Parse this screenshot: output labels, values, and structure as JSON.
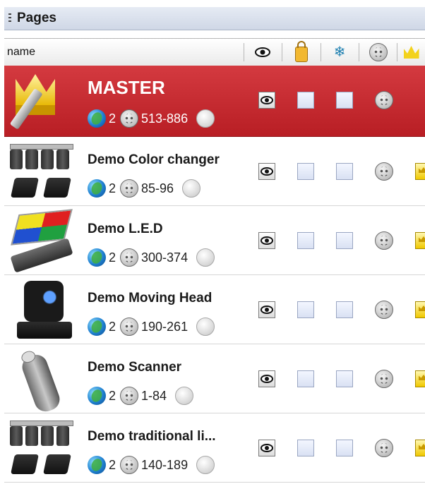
{
  "panel": {
    "title": "Pages"
  },
  "columns": {
    "name_label": "name",
    "icons": [
      "eye-icon",
      "lock-icon",
      "snowflake-icon",
      "dmx-icon",
      "crown-icon"
    ]
  },
  "colors": {
    "master_bg": "#c8282e",
    "row_bg": "#ffffff",
    "header_bg": "#dfe5ef"
  },
  "rows": [
    {
      "name": "MASTER",
      "universe": "2",
      "range": "513-886",
      "type": "master",
      "has_crown_control": false
    },
    {
      "name": "Demo Color changer",
      "universe": "2",
      "range": "85-96",
      "type": "par-cans",
      "has_crown_control": true
    },
    {
      "name": "Demo L.E.D",
      "universe": "2",
      "range": "300-374",
      "type": "led",
      "has_crown_control": true
    },
    {
      "name": "Demo Moving Head",
      "universe": "2",
      "range": "190-261",
      "type": "moving-head",
      "has_crown_control": true
    },
    {
      "name": "Demo Scanner",
      "universe": "2",
      "range": "1-84",
      "type": "scanner",
      "has_crown_control": true
    },
    {
      "name": "Demo traditional li...",
      "universe": "2",
      "range": "140-189",
      "type": "par-cans",
      "has_crown_control": true
    }
  ]
}
